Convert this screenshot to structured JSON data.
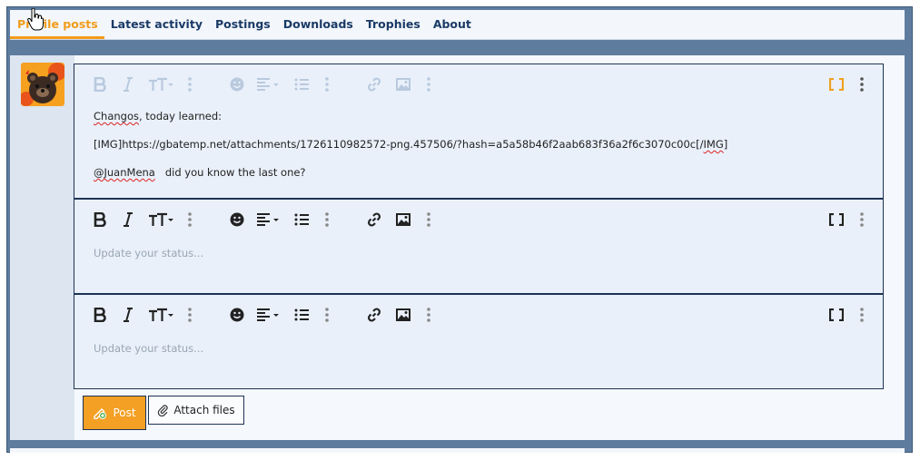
{
  "tabs": [
    {
      "label": "Profile posts",
      "active": true
    },
    {
      "label": "Latest activity",
      "active": false
    },
    {
      "label": "Postings",
      "active": false
    },
    {
      "label": "Downloads",
      "active": false
    },
    {
      "label": "Trophies",
      "active": false
    },
    {
      "label": "About",
      "active": false
    }
  ],
  "editor1": {
    "line1_word": "Changos",
    "line1_rest": ", today learned:",
    "line2_start": "[IMG]https://gbatemp.net/attachments/1726110982572-png.457506/?hash=a5a58b46f2aab683f36a2f6c3070c00c[/",
    "line2_squig": "IMG",
    "line2_end": "]",
    "line3_mention": "@JuanMena",
    "line3_rest": "   did you know the last one?"
  },
  "editor2": {
    "placeholder": "Update your status..."
  },
  "editor3": {
    "placeholder": "Update your status..."
  },
  "buttons": {
    "post": "Post",
    "attach": "Attach files"
  },
  "colors": {
    "accent": "#f19c1c",
    "frame": "#5e7c9e",
    "editor_bg": "#e9f0fa",
    "nav_text": "#1a3a66"
  }
}
